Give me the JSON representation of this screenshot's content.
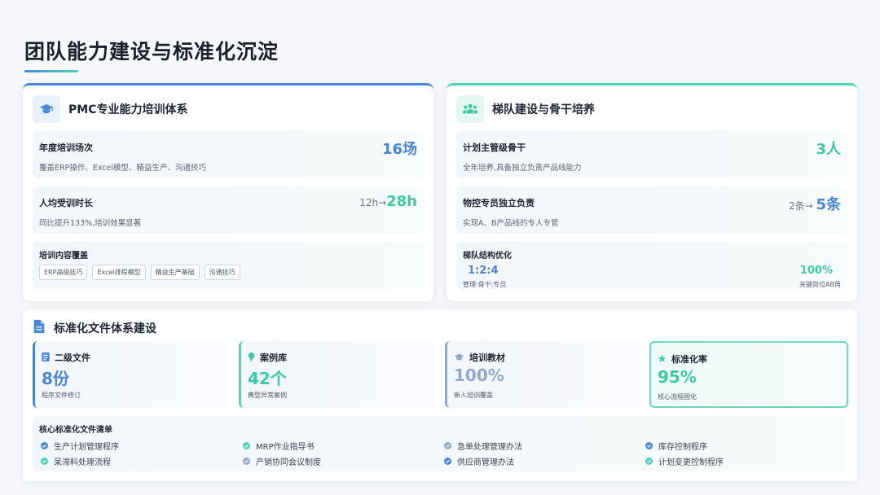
{
  "page": {
    "title": "团队能力建设与标准化沉淀"
  },
  "pmc_card": {
    "title": "PMC专业能力培训体系",
    "icon": "graduation-cap-icon",
    "rows": [
      {
        "title": "年度培训场次",
        "sub": "覆盖ERP操作、Excel模型、精益生产、沟通技巧",
        "value": "16场"
      },
      {
        "title": "人均受训时长",
        "sub": "同比提升133%,培训效果显著",
        "from": "12h→",
        "value": "28h"
      }
    ],
    "coverage": {
      "title": "培训内容覆盖",
      "tags": [
        "ERP高级技巧",
        "Excel排程模型",
        "精益生产基础",
        "沟通技巧"
      ]
    }
  },
  "ladder_card": {
    "title": "梯队建设与骨干培养",
    "icon": "team-icon",
    "rows": [
      {
        "title": "计划主管级骨干",
        "sub": "全年培养,具备独立负责产品线能力",
        "value": "3人"
      },
      {
        "title": "物控专员独立负责",
        "sub": "实现A、B产品线的专人专管",
        "from": "2条→ ",
        "value": "5条"
      }
    ],
    "structure": {
      "title": "梯队结构优化",
      "ratio": "1:2:4",
      "ratio_sub": "管理:骨干:专员",
      "pct": "100%",
      "pct_sub": "关键岗位AB角"
    }
  },
  "std_card": {
    "title": "标准化文件体系建设",
    "icon": "document-icon",
    "stats": [
      {
        "label": "二级文件",
        "value": "8份",
        "sub": "程序文件修订",
        "icon": "file-icon"
      },
      {
        "label": "案例库",
        "value": "42个",
        "sub": "典型异常案例",
        "icon": "lightbulb-icon"
      },
      {
        "label": "培训教材",
        "value": "100%",
        "sub": "新人培训覆盖",
        "icon": "graduation-cap-icon"
      },
      {
        "label": "标准化率",
        "value": "95%",
        "sub": "核心流程固化",
        "icon": "star-icon"
      }
    ],
    "list": {
      "title": "核心标准化文件清单",
      "items": [
        "生产计划管理程序",
        "MRP作业指导书",
        "急单处理管理办法",
        "库存控制程序",
        "呆滞料处理流程",
        "产销协同会议制度",
        "供应商管理办法",
        "计划变更控制程序"
      ]
    }
  },
  "colors": {
    "blue": "#4a86d4",
    "teal": "#4fd1b8",
    "gray": "#8fa8cc"
  }
}
